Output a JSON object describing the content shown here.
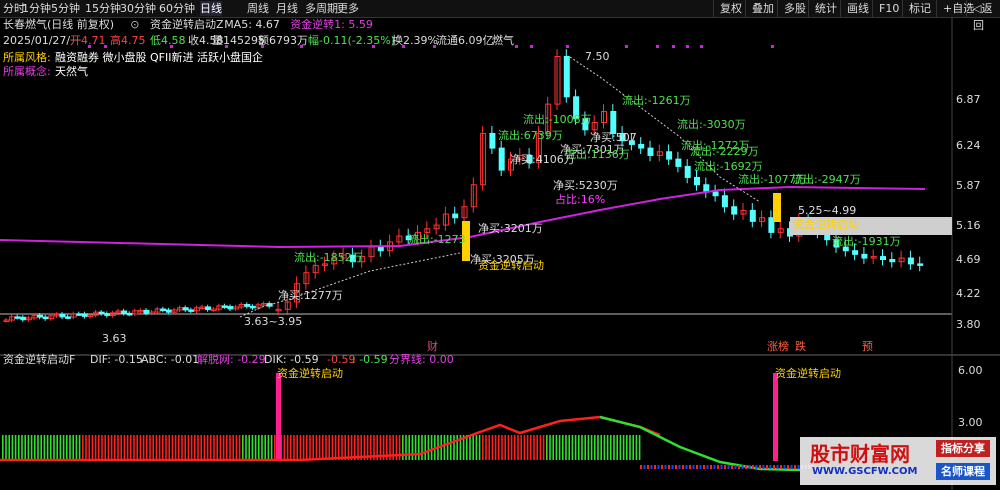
{
  "toolbar": {
    "periods": [
      "分时",
      "1分钟",
      "5分钟",
      "15分钟",
      "30分钟",
      "60分钟",
      "日线",
      "周线",
      "月线",
      "多周期",
      "更多"
    ],
    "active": "日线",
    "right": [
      "复权",
      "叠加",
      "多股",
      "统计",
      "画线",
      "F10",
      "标记",
      "+自选",
      "◁返回"
    ]
  },
  "header": {
    "stock": "长春燃气(日线 前复权)",
    "indicator": "资金逆转启动Z",
    "ma5": "MA5: 4.67",
    "ind_val": "资金逆转1: 5.59",
    "date": "2025/01/27/一",
    "open": "开4.71",
    "high": "高4.75",
    "low": "低4.58",
    "close": "收4.58",
    "vol": "量145295",
    "amount": "额6793万",
    "change": "幅-0.11(-2.35%)",
    "turnover": "换2.39%",
    "float": "流通6.09亿",
    "concept": "燃气"
  },
  "info": {
    "style_label": "所属风格:",
    "style_value": "融资融券 微小盘股 QFII新进 活跃小盘国企",
    "concept_label": "所属概念:",
    "concept_value": "天然气"
  },
  "colors": {
    "up": "#ff3232",
    "down": "#54ffff",
    "ma": "#d020e0",
    "text_green": "#50e050",
    "yellow": "#ffd000",
    "mag": "#ff2090"
  },
  "price_axis": [
    "6.87",
    "6.24",
    "5.87",
    "5.16",
    "4.69",
    "4.22",
    "3.80"
  ],
  "annotations": [
    {
      "text": "7.50",
      "color": "#ddd"
    },
    {
      "text": "3.63",
      "color": "#ddd"
    },
    {
      "text": "3.63~3.95",
      "color": "#ddd"
    },
    {
      "text": "流出:-1852万",
      "color": "#50e050"
    },
    {
      "text": "净买:1277万",
      "color": "#ddd"
    },
    {
      "text": "流出:-1273",
      "color": "#50e050"
    },
    {
      "text": "净买:3201万",
      "color": "#ddd"
    },
    {
      "text": "净买:3205万",
      "color": "#ddd"
    },
    {
      "text": "流出:-1008万",
      "color": "#50e050"
    },
    {
      "text": "流出:6739万",
      "color": "#50e050"
    },
    {
      "text": "净买:7301万",
      "color": "#ddd"
    },
    {
      "text": "流出:1136万",
      "color": "#50e050"
    },
    {
      "text": "净买:4106万",
      "color": "#ddd"
    },
    {
      "text": "净买:5230万",
      "color": "#ddd"
    },
    {
      "text": "占比:16%",
      "color": "#ff40ff"
    },
    {
      "text": "净买:507",
      "color": "#ddd"
    },
    {
      "text": "流出:-1261万",
      "color": "#50e050"
    },
    {
      "text": "流出:-3030万",
      "color": "#50e050"
    },
    {
      "text": "流出:-1272万",
      "color": "#50e050"
    },
    {
      "text": "流出:-2229万",
      "color": "#50e050"
    },
    {
      "text": "流出:-1692万",
      "color": "#50e050"
    },
    {
      "text": "流出:-1077万",
      "color": "#50e050"
    },
    {
      "text": "流出:-2947万",
      "color": "#50e050"
    },
    {
      "text": "5.25~4.99",
      "color": "#ddd"
    },
    {
      "text": "流出:-1931万",
      "color": "#50e050"
    },
    {
      "text": "资金逆转启动",
      "color": "#ffd000"
    },
    {
      "text": "资金逆转启动",
      "color": "#ffd000"
    },
    {
      "text": "财",
      "color": "#d05070"
    },
    {
      "text": "涨榜",
      "color": "#ff6040"
    },
    {
      "text": "跌",
      "color": "#ff6040"
    },
    {
      "text": "预",
      "color": "#ff6040"
    }
  ],
  "lower": {
    "title": "资金逆转启动F",
    "dif": "DIF: -0.15",
    "abc": "ABC: -0.01",
    "jfw": "解脱网: -0.29",
    "dik": "DIK: -0.59",
    "v1": "-0.59",
    "v2": ": -0.59",
    "fjx": "分界线: 0.00",
    "axis": [
      "6.00",
      "3.00"
    ],
    "signal_label": "资金逆转启动"
  },
  "watermark": {
    "title": "股市财富网",
    "url": "WWW.GSCFW.COM",
    "btn1": "指标分享",
    "btn2": "名师课程"
  }
}
